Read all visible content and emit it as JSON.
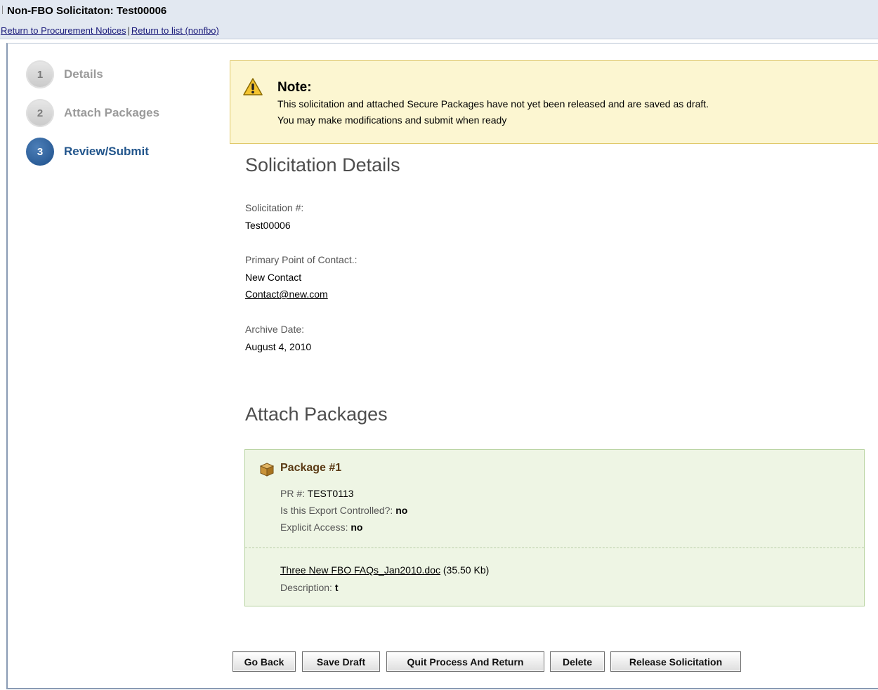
{
  "header": {
    "title": "Non-FBO Solicitaton: Test00006",
    "link_procurement": "Return to Procurement Notices",
    "separator": "|",
    "link_list": "Return to list (nonfbo)"
  },
  "steps": [
    {
      "number": "1",
      "label": "Details",
      "state": "inactive"
    },
    {
      "number": "2",
      "label": "Attach Packages",
      "state": "inactive"
    },
    {
      "number": "3",
      "label": "Review/Submit",
      "state": "active"
    }
  ],
  "note": {
    "icon": "warning-icon",
    "title": "Note:",
    "line1": "This solicitation and attached Secure Packages have not yet been released and are saved as draft.",
    "line2": "You may make modifications and submit when ready"
  },
  "details": {
    "heading": "Solicitation Details",
    "solicitation_label": "Solicitation #:",
    "solicitation_value": "Test00006",
    "contact_label": "Primary Point of Contact.:",
    "contact_name": "New Contact",
    "contact_email": "Contact@new.com",
    "archive_label": "Archive Date:",
    "archive_value": "August 4, 2010"
  },
  "packages": {
    "heading": "Attach Packages",
    "items": [
      {
        "icon": "package-icon",
        "title": "Package #1",
        "pr_label": "PR #:",
        "pr_value": "TEST0113",
        "export_label": "Is this Export Controlled?:",
        "export_value": "no",
        "access_label": "Explicit Access:",
        "access_value": "no",
        "file_name": "Three New FBO FAQs_Jan2010.doc",
        "file_size": "(35.50 Kb)",
        "description_label": "Description:",
        "description_value": "t"
      }
    ]
  },
  "buttons": {
    "go_back": "Go Back",
    "save_draft": "Save Draft",
    "quit": "Quit Process And Return",
    "delete": "Delete",
    "release": "Release Solicitation"
  },
  "colors": {
    "active_step": "#23568c",
    "note_background": "#fcf6d1",
    "package_background": "#eef5e4"
  }
}
